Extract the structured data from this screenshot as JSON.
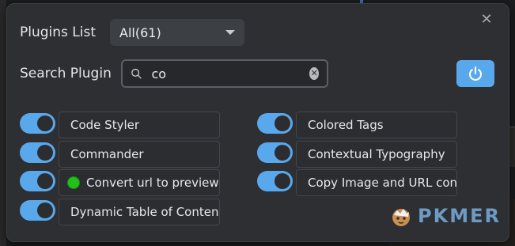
{
  "header": {
    "close_glyph": "✕"
  },
  "filter": {
    "label": "Plugins List",
    "selected": "All(61)"
  },
  "search": {
    "label": "Search Plugin",
    "value": "co",
    "clear_glyph": "✕"
  },
  "plugins_left": [
    {
      "name": "Code Styler",
      "enabled": true,
      "status": ""
    },
    {
      "name": "Commander",
      "enabled": true,
      "status": ""
    },
    {
      "name": "Convert url to preview",
      "enabled": true,
      "status": "green"
    },
    {
      "name": "Dynamic Table of Content",
      "enabled": true,
      "status": ""
    }
  ],
  "plugins_right": [
    {
      "name": "Colored Tags",
      "enabled": true,
      "status": ""
    },
    {
      "name": "Contextual Typography",
      "enabled": true,
      "status": ""
    },
    {
      "name": "Copy Image and URL cont",
      "enabled": true,
      "status": ""
    }
  ],
  "watermark": {
    "text": "PKMER"
  },
  "colors": {
    "accent": "#5aa8ec",
    "panel": "#2d2f33",
    "status_green": "#22c11a"
  }
}
